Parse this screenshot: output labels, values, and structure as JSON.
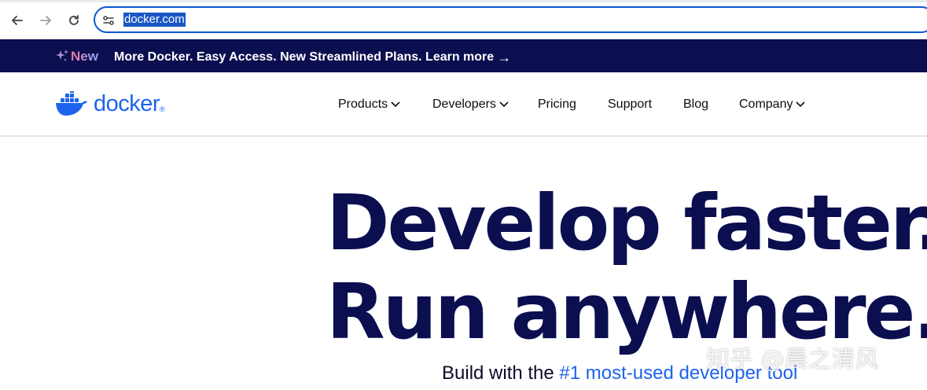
{
  "browser": {
    "url": "docker.com",
    "back_icon": "arrow-left-icon",
    "forward_icon": "arrow-right-icon",
    "reload_icon": "reload-icon",
    "site_info_icon": "tune-icon"
  },
  "announcement": {
    "badge": "New",
    "message": "More Docker. Easy Access. New Streamlined Plans. Learn more",
    "arrow": "→",
    "bg_color": "#0b0e4f"
  },
  "header": {
    "logo_text": "docker",
    "logo_registered": "®",
    "nav": [
      {
        "label": "Products",
        "has_dropdown": true
      },
      {
        "label": "Developers",
        "has_dropdown": true
      },
      {
        "label": "Pricing",
        "has_dropdown": false
      },
      {
        "label": "Support",
        "has_dropdown": false
      },
      {
        "label": "Blog",
        "has_dropdown": false
      },
      {
        "label": "Company",
        "has_dropdown": true
      }
    ]
  },
  "hero": {
    "line1": "Develop faster.",
    "line2": "Run anywhere.",
    "sub_prefix": "Build with the ",
    "sub_highlight": "#1 most-used developer tool",
    "highlight_color": "#1d63ed"
  },
  "watermark": "知乎 @晨之清风"
}
